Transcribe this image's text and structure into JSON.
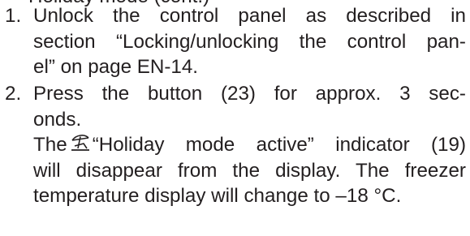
{
  "cut_off_heading": "Holiday mode (cont.)",
  "steps": [
    {
      "number": "1.",
      "lines": [
        "Unlock the control panel as described in",
        "section “Locking/unlocking the control pan-",
        "el” on page EN-14."
      ]
    },
    {
      "number": "2.",
      "lines": [
        "Press the button (23) for approx. 3 sec-",
        "onds."
      ],
      "result_prefix": "The",
      "result_icon": "holiday-mode-icon",
      "result_line1_rest": "“Holiday mode active” indicator (19)",
      "result_lines": [
        "will disappear from the display. The freezer",
        "temperature display will change to –18 °C."
      ]
    }
  ]
}
